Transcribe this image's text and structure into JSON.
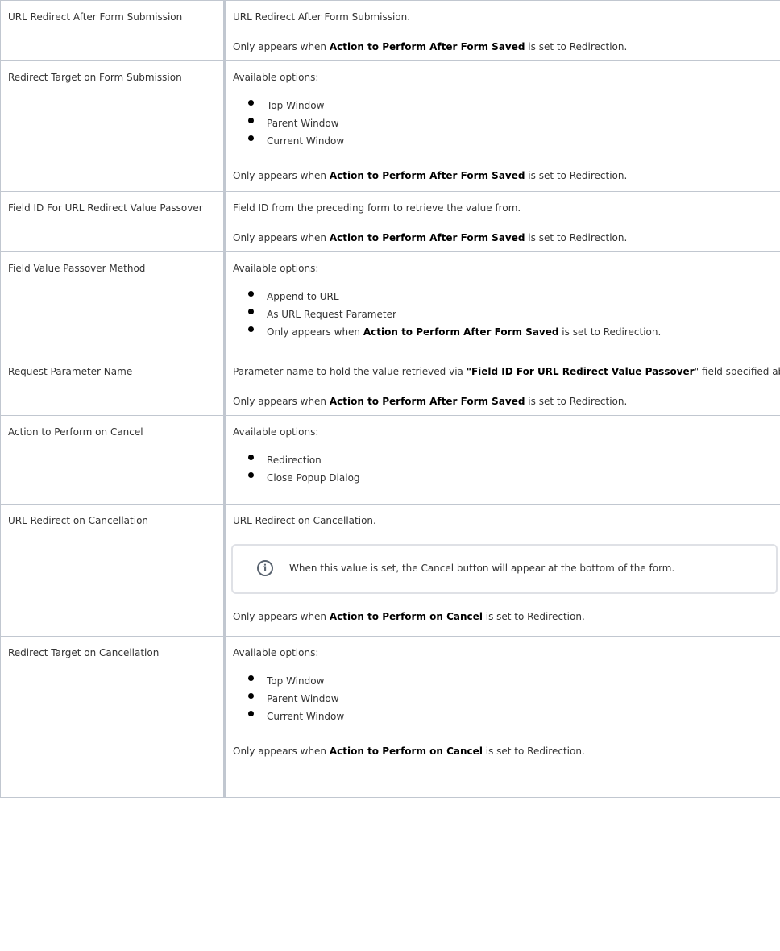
{
  "rows": [
    {
      "name": "URL Redirect After Form Submission",
      "desc": "URL Redirect After Form Submission.",
      "note": {
        "pre": "Only appears when ",
        "strong": "Action to Perform After Form Saved",
        "post": " is set to Redirection."
      }
    },
    {
      "name": "Redirect Target on Form Submission",
      "desc": "Available options:",
      "options": [
        "Top Window",
        "Parent Window",
        "Current Window"
      ],
      "note": {
        "pre": "Only appears when ",
        "strong": "Action to Perform After Form Saved",
        "post": " is set to Redirection."
      }
    },
    {
      "name": "Field ID For URL Redirect Value Passover",
      "desc": "Field ID from the preceding form to retrieve the value from.",
      "note": {
        "pre": "Only appears when ",
        "strong": "Action to Perform After Form Saved",
        "post": " is set to Redirection."
      }
    },
    {
      "name": "Field Value Passover Method",
      "desc": "Available options:",
      "options": [
        "Append to URL",
        "As URL Request Parameter"
      ],
      "option_note": {
        "pre": "Only appears when ",
        "strong": "Action to Perform After Form Saved",
        "post": " is set to Redirection."
      }
    },
    {
      "name": "Request Parameter Name",
      "desc_pre": "Parameter name to hold the value retrieved via ",
      "desc_strong": "\"Field ID For URL Redirect Value Passover",
      "desc_post": "\" field specified above.",
      "note": {
        "pre": "Only appears when ",
        "strong": "Action to Perform After Form Saved",
        "post": " is set to Redirection."
      }
    },
    {
      "name": "Action to Perform on Cancel",
      "desc": "Available options:",
      "options": [
        "Redirection",
        "Close Popup Dialog"
      ]
    },
    {
      "name": "URL Redirect on Cancellation",
      "desc": "URL Redirect on Cancellation.",
      "info": {
        "icon": "info-icon",
        "text": "When this value is set, the Cancel button will appear at the bottom of the form."
      },
      "note": {
        "pre": "Only appears when ",
        "strong": "Action to Perform on Cancel",
        "post": " is set to Redirection."
      }
    },
    {
      "name": "Redirect Target on Cancellation",
      "desc": "Available options:",
      "options": [
        "Top Window",
        "Parent Window",
        "Current Window"
      ],
      "note": {
        "pre": "Only appears when ",
        "strong": "Action to Perform on Cancel",
        "post": " is set to Redirection."
      }
    }
  ]
}
